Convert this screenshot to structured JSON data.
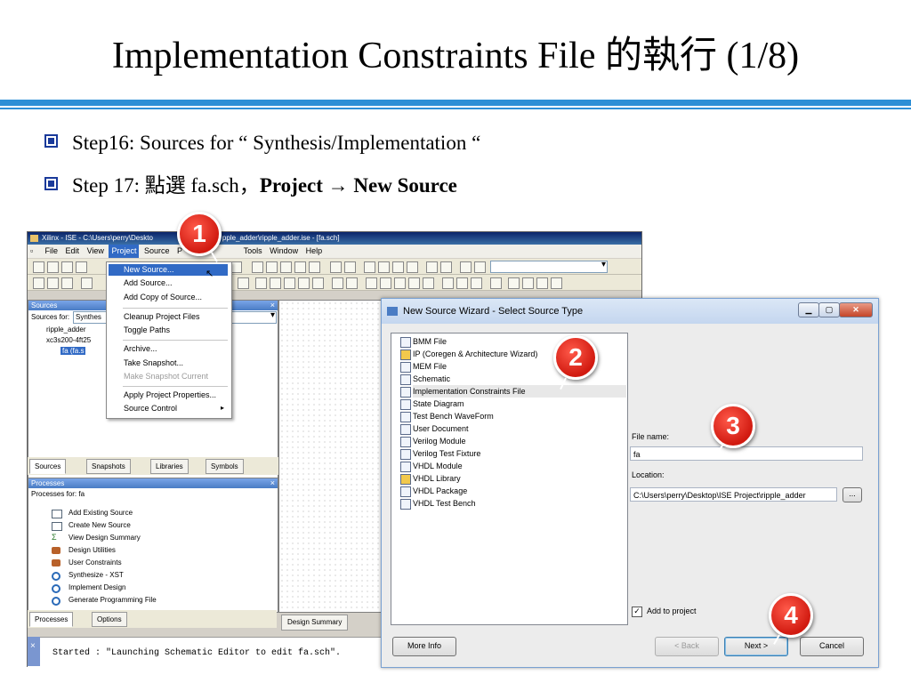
{
  "slide": {
    "title": "Implementation Constraints File 的執行 (1/8)",
    "bullet1": "Step16: Sources for “ Synthesis/Implementation “",
    "bullet2_prefix": "Step 17: 點選 fa.sch，",
    "bullet2_bold1": "Project",
    "bullet2_arrow": " → ",
    "bullet2_bold2": "New Source"
  },
  "ise": {
    "title": "Xilinx - ISE - C:\\Users\\perry\\Deskto",
    "title_tail": "pple_adder\\ripple_adder.ise - [fa.sch]",
    "menu": [
      "File",
      "Edit",
      "View",
      "Project",
      "Source",
      "P",
      "Tools",
      "Window",
      "Help"
    ],
    "sources_title": "Sources",
    "sources_for_label": "Sources for:",
    "sources_for_value": "Synthes",
    "tree": [
      "ripple_adder",
      "xc3s200-4ft25",
      "fa (fa.s"
    ],
    "tabs": [
      "Sources",
      "Snapshots",
      "Libraries",
      "Symbols"
    ],
    "processes_title": "Processes",
    "processes_for": "Processes for: fa",
    "processes": [
      "Add Existing Source",
      "Create New Source",
      "View Design Summary",
      "Design Utilities",
      "User Constraints",
      "Synthesize - XST",
      "Implement Design",
      "Generate Programming File"
    ],
    "ptabs": [
      "Processes",
      "Options"
    ],
    "design_summary_tab": "Design Summary",
    "console": "Started : \"Launching Schematic Editor to edit fa.sch\"."
  },
  "dropdown": {
    "items": [
      "New Source...",
      "Add Source...",
      "Add Copy of Source...",
      "Cleanup Project Files",
      "Toggle Paths",
      "Archive...",
      "Take Snapshot...",
      "Make Snapshot Current",
      "Apply Project Properties...",
      "Source Control"
    ]
  },
  "wizard": {
    "title": "New Source Wizard - Select Source Type",
    "types": [
      "BMM File",
      "IP (Coregen & Architecture Wizard)",
      "MEM File",
      "Schematic",
      "Implementation Constraints File",
      "State Diagram",
      "Test Bench WaveForm",
      "User Document",
      "Verilog Module",
      "Verilog Test Fixture",
      "VHDL Module",
      "VHDL Library",
      "VHDL Package",
      "VHDL Test Bench"
    ],
    "file_name_label": "File name:",
    "file_name_value": "fa",
    "location_label": "Location:",
    "location_value": "C:\\Users\\perry\\Desktop\\ISE Project\\ripple_adder",
    "browse": "...",
    "add_to_project": "Add to project",
    "check": "✓",
    "more_info": "More Info",
    "back": "< Back",
    "next": "Next >",
    "cancel": "Cancel"
  },
  "markers": [
    "1",
    "2",
    "3",
    "4"
  ]
}
